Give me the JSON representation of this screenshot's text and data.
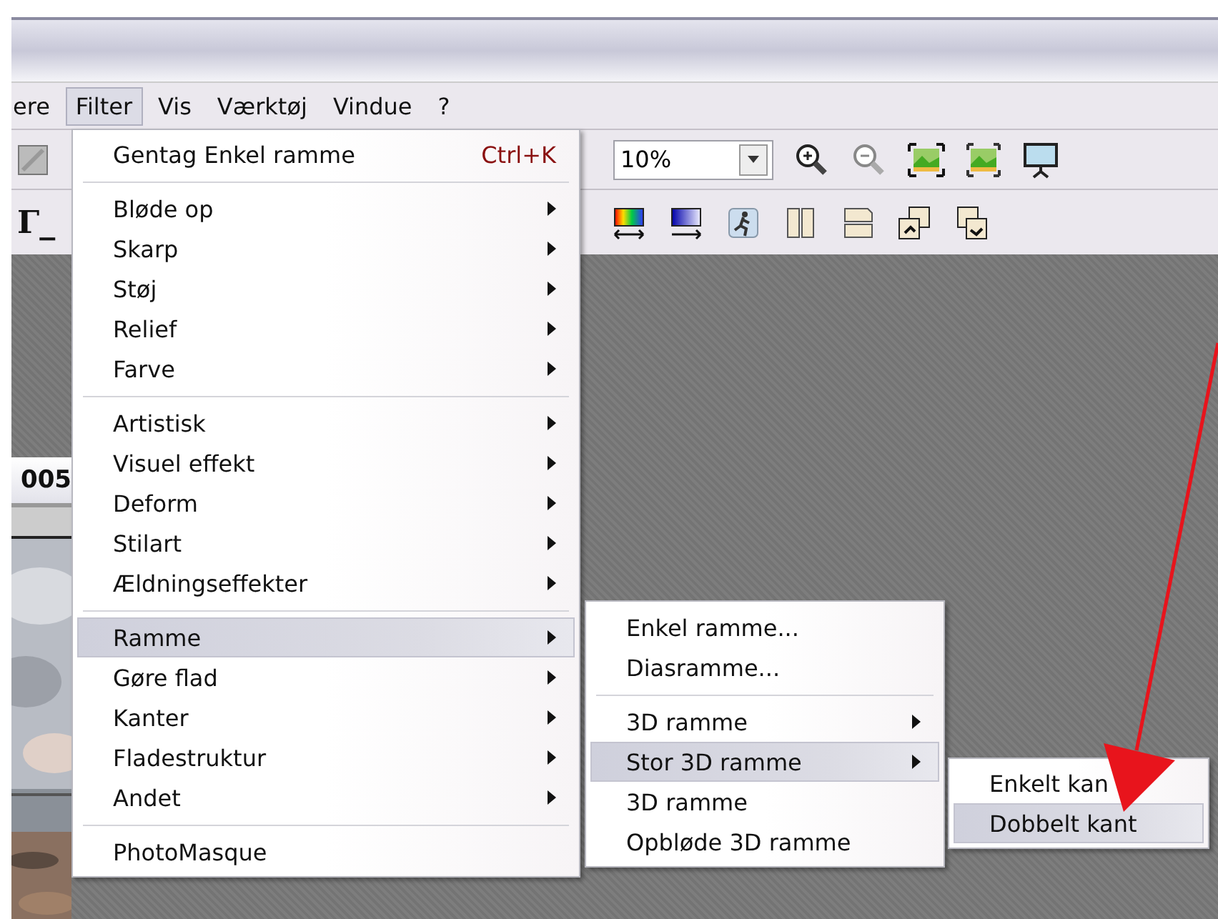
{
  "menubar": [
    {
      "label": "ere",
      "selected": false
    },
    {
      "label": "Filter",
      "selected": true
    },
    {
      "label": "Vis",
      "selected": false
    },
    {
      "label": "Værktøj",
      "selected": false
    },
    {
      "label": "Vindue",
      "selected": false
    },
    {
      "label": "?",
      "selected": false
    }
  ],
  "zoom_field": {
    "value": "10%"
  },
  "toolbar_glyph": "Γ_",
  "document": {
    "title": "005"
  },
  "filter_menu": [
    {
      "kind": "item",
      "label": "Gentag Enkel ramme",
      "shortcut": "Ctrl+K",
      "has_submenu": false,
      "selected": false
    },
    {
      "kind": "separator"
    },
    {
      "kind": "item",
      "label": "Bløde op",
      "has_submenu": true,
      "selected": false
    },
    {
      "kind": "item",
      "label": "Skarp",
      "has_submenu": true,
      "selected": false
    },
    {
      "kind": "item",
      "label": "Støj",
      "has_submenu": true,
      "selected": false
    },
    {
      "kind": "item",
      "label": "Relief",
      "has_submenu": true,
      "selected": false
    },
    {
      "kind": "item",
      "label": "Farve",
      "has_submenu": true,
      "selected": false
    },
    {
      "kind": "separator"
    },
    {
      "kind": "item",
      "label": "Artistisk",
      "has_submenu": true,
      "selected": false
    },
    {
      "kind": "item",
      "label": "Visuel effekt",
      "has_submenu": true,
      "selected": false
    },
    {
      "kind": "item",
      "label": "Deform",
      "has_submenu": true,
      "selected": false
    },
    {
      "kind": "item",
      "label": "Stilart",
      "has_submenu": true,
      "selected": false
    },
    {
      "kind": "item",
      "label": "Ældningseffekter",
      "has_submenu": true,
      "selected": false
    },
    {
      "kind": "separator"
    },
    {
      "kind": "item",
      "label": "Ramme",
      "has_submenu": true,
      "selected": true
    },
    {
      "kind": "item",
      "label": "Gøre flad",
      "has_submenu": true,
      "selected": false
    },
    {
      "kind": "item",
      "label": "Kanter",
      "has_submenu": true,
      "selected": false
    },
    {
      "kind": "item",
      "label": "Fladestruktur",
      "has_submenu": true,
      "selected": false
    },
    {
      "kind": "item",
      "label": "Andet",
      "has_submenu": true,
      "selected": false
    },
    {
      "kind": "separator"
    },
    {
      "kind": "item",
      "label": "PhotoMasque",
      "has_submenu": false,
      "selected": false
    }
  ],
  "ramme_menu": [
    {
      "kind": "item",
      "label": "Enkel ramme...",
      "has_submenu": false,
      "selected": false
    },
    {
      "kind": "item",
      "label": "Diasramme...",
      "has_submenu": false,
      "selected": false
    },
    {
      "kind": "separator"
    },
    {
      "kind": "item",
      "label": "3D ramme",
      "has_submenu": true,
      "selected": false
    },
    {
      "kind": "item",
      "label": "Stor 3D ramme",
      "has_submenu": true,
      "selected": true
    },
    {
      "kind": "item",
      "label": "3D ramme",
      "has_submenu": false,
      "selected": false
    },
    {
      "kind": "item",
      "label": "Opbløde 3D ramme",
      "has_submenu": false,
      "selected": false
    }
  ],
  "stor_3d_menu": [
    {
      "kind": "item",
      "label": "Enkelt kan",
      "has_submenu": false,
      "selected": false
    },
    {
      "kind": "item",
      "label": "Dobbelt kant",
      "has_submenu": false,
      "selected": true
    }
  ]
}
